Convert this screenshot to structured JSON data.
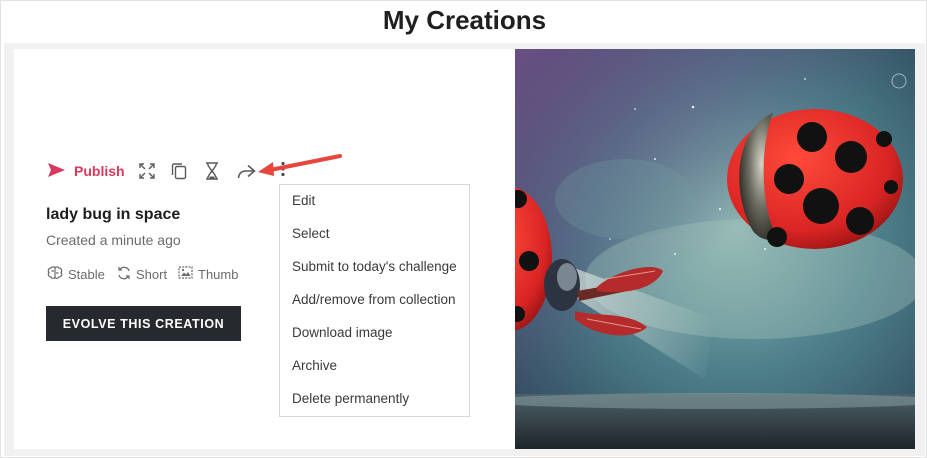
{
  "page_title": "My Creations",
  "toolbar": {
    "publish_label": "Publish",
    "icons": [
      "send-icon",
      "expand-icon",
      "copy-icon",
      "hourglass-icon",
      "share-icon",
      "more-vertical-icon"
    ]
  },
  "creation": {
    "title": "lady bug in space",
    "created": "Created a minute ago",
    "tags": [
      {
        "icon": "brain-icon",
        "label": "Stable"
      },
      {
        "icon": "refresh-icon",
        "label": "Short"
      },
      {
        "icon": "image-icon",
        "label": "Thumb"
      }
    ]
  },
  "evolve_button": "EVOLVE THIS CREATION",
  "menu": {
    "items": [
      "Edit",
      "Select",
      "Submit to today's challenge",
      "Add/remove from collection",
      "Download image",
      "Archive",
      "Delete permanently"
    ]
  },
  "colors": {
    "accent": "#d6395b",
    "button_dark": "#262a2e",
    "callout_arrow": "#e8453c",
    "ladybug_red": "#d92424"
  }
}
